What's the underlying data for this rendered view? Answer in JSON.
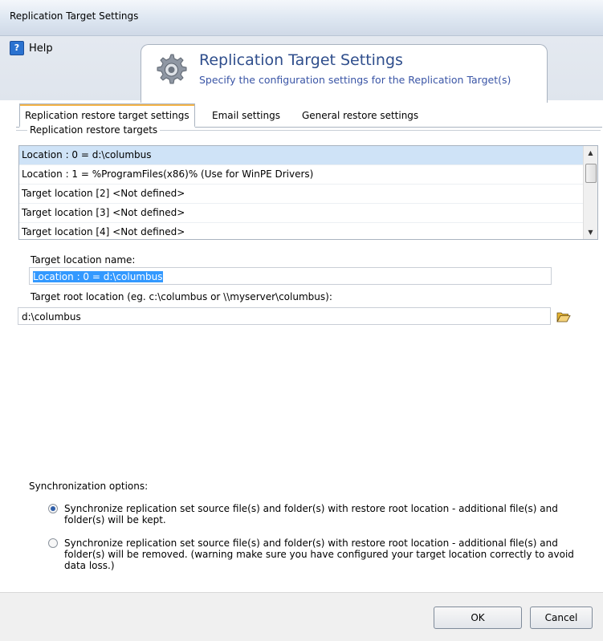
{
  "window": {
    "title": "Replication Target Settings"
  },
  "header": {
    "title": "Replication Target Settings",
    "subtitle": "Specify the configuration settings for the Replication Target(s)",
    "help_label": "Help",
    "icon": "gear-icon"
  },
  "tabs": [
    {
      "label": "Replication restore target settings",
      "active": true
    },
    {
      "label": "Email settings",
      "active": false
    },
    {
      "label": "General restore settings",
      "active": false
    }
  ],
  "targets": {
    "group_label": "Replication restore targets",
    "items": [
      "Location : 0 = d:\\columbus",
      "Location : 1 = %ProgramFiles(x86)% (Use for WinPE Drivers)",
      "Target location [2] <Not defined>",
      "Target location [3] <Not defined>",
      "Target location [4] <Not defined>"
    ],
    "selected_index": 0
  },
  "form": {
    "name_label": "Target location name:",
    "name_value": "Location : 0 = d:\\columbus",
    "root_label": "Target root location (eg. c:\\columbus or \\\\myserver\\columbus):",
    "root_value": "d:\\columbus",
    "browse_icon": "folder-open-icon"
  },
  "sync": {
    "label": "Synchronization options:",
    "options": [
      {
        "text": "Synchronize replication set source file(s) and folder(s) with restore root location - additional file(s) and folder(s) will be kept.",
        "checked": true
      },
      {
        "text": "Synchronize replication set source file(s) and folder(s) with restore root location - additional file(s) and folder(s) will be removed. (warning make sure you have configured your target location correctly to avoid data loss.)",
        "checked": false
      }
    ]
  },
  "buttons": {
    "ok": "OK",
    "cancel": "Cancel"
  },
  "colors": {
    "header_text": "#2f4e8c",
    "selection": "#cfe3f7",
    "active_tab_accent": "#f5b54a"
  }
}
